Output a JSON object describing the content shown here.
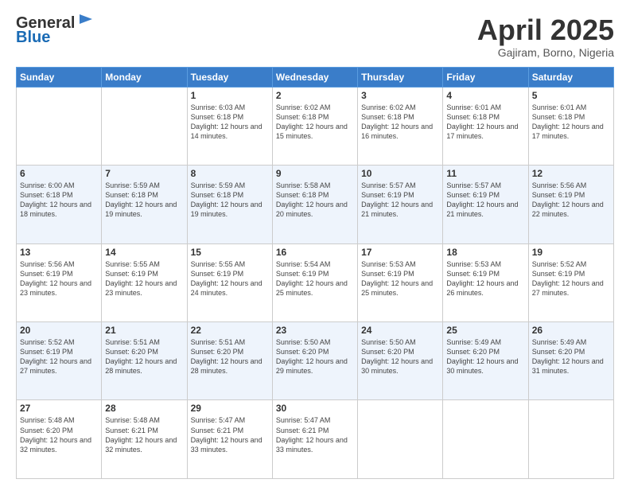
{
  "header": {
    "logo_general": "General",
    "logo_blue": "Blue",
    "month_title": "April 2025",
    "location": "Gajiram, Borno, Nigeria"
  },
  "weekdays": [
    "Sunday",
    "Monday",
    "Tuesday",
    "Wednesday",
    "Thursday",
    "Friday",
    "Saturday"
  ],
  "weeks": [
    [
      {
        "day": "",
        "sunrise": "",
        "sunset": "",
        "daylight": ""
      },
      {
        "day": "",
        "sunrise": "",
        "sunset": "",
        "daylight": ""
      },
      {
        "day": "1",
        "sunrise": "Sunrise: 6:03 AM",
        "sunset": "Sunset: 6:18 PM",
        "daylight": "Daylight: 12 hours and 14 minutes."
      },
      {
        "day": "2",
        "sunrise": "Sunrise: 6:02 AM",
        "sunset": "Sunset: 6:18 PM",
        "daylight": "Daylight: 12 hours and 15 minutes."
      },
      {
        "day": "3",
        "sunrise": "Sunrise: 6:02 AM",
        "sunset": "Sunset: 6:18 PM",
        "daylight": "Daylight: 12 hours and 16 minutes."
      },
      {
        "day": "4",
        "sunrise": "Sunrise: 6:01 AM",
        "sunset": "Sunset: 6:18 PM",
        "daylight": "Daylight: 12 hours and 17 minutes."
      },
      {
        "day": "5",
        "sunrise": "Sunrise: 6:01 AM",
        "sunset": "Sunset: 6:18 PM",
        "daylight": "Daylight: 12 hours and 17 minutes."
      }
    ],
    [
      {
        "day": "6",
        "sunrise": "Sunrise: 6:00 AM",
        "sunset": "Sunset: 6:18 PM",
        "daylight": "Daylight: 12 hours and 18 minutes."
      },
      {
        "day": "7",
        "sunrise": "Sunrise: 5:59 AM",
        "sunset": "Sunset: 6:18 PM",
        "daylight": "Daylight: 12 hours and 19 minutes."
      },
      {
        "day": "8",
        "sunrise": "Sunrise: 5:59 AM",
        "sunset": "Sunset: 6:18 PM",
        "daylight": "Daylight: 12 hours and 19 minutes."
      },
      {
        "day": "9",
        "sunrise": "Sunrise: 5:58 AM",
        "sunset": "Sunset: 6:18 PM",
        "daylight": "Daylight: 12 hours and 20 minutes."
      },
      {
        "day": "10",
        "sunrise": "Sunrise: 5:57 AM",
        "sunset": "Sunset: 6:19 PM",
        "daylight": "Daylight: 12 hours and 21 minutes."
      },
      {
        "day": "11",
        "sunrise": "Sunrise: 5:57 AM",
        "sunset": "Sunset: 6:19 PM",
        "daylight": "Daylight: 12 hours and 21 minutes."
      },
      {
        "day": "12",
        "sunrise": "Sunrise: 5:56 AM",
        "sunset": "Sunset: 6:19 PM",
        "daylight": "Daylight: 12 hours and 22 minutes."
      }
    ],
    [
      {
        "day": "13",
        "sunrise": "Sunrise: 5:56 AM",
        "sunset": "Sunset: 6:19 PM",
        "daylight": "Daylight: 12 hours and 23 minutes."
      },
      {
        "day": "14",
        "sunrise": "Sunrise: 5:55 AM",
        "sunset": "Sunset: 6:19 PM",
        "daylight": "Daylight: 12 hours and 23 minutes."
      },
      {
        "day": "15",
        "sunrise": "Sunrise: 5:55 AM",
        "sunset": "Sunset: 6:19 PM",
        "daylight": "Daylight: 12 hours and 24 minutes."
      },
      {
        "day": "16",
        "sunrise": "Sunrise: 5:54 AM",
        "sunset": "Sunset: 6:19 PM",
        "daylight": "Daylight: 12 hours and 25 minutes."
      },
      {
        "day": "17",
        "sunrise": "Sunrise: 5:53 AM",
        "sunset": "Sunset: 6:19 PM",
        "daylight": "Daylight: 12 hours and 25 minutes."
      },
      {
        "day": "18",
        "sunrise": "Sunrise: 5:53 AM",
        "sunset": "Sunset: 6:19 PM",
        "daylight": "Daylight: 12 hours and 26 minutes."
      },
      {
        "day": "19",
        "sunrise": "Sunrise: 5:52 AM",
        "sunset": "Sunset: 6:19 PM",
        "daylight": "Daylight: 12 hours and 27 minutes."
      }
    ],
    [
      {
        "day": "20",
        "sunrise": "Sunrise: 5:52 AM",
        "sunset": "Sunset: 6:19 PM",
        "daylight": "Daylight: 12 hours and 27 minutes."
      },
      {
        "day": "21",
        "sunrise": "Sunrise: 5:51 AM",
        "sunset": "Sunset: 6:20 PM",
        "daylight": "Daylight: 12 hours and 28 minutes."
      },
      {
        "day": "22",
        "sunrise": "Sunrise: 5:51 AM",
        "sunset": "Sunset: 6:20 PM",
        "daylight": "Daylight: 12 hours and 28 minutes."
      },
      {
        "day": "23",
        "sunrise": "Sunrise: 5:50 AM",
        "sunset": "Sunset: 6:20 PM",
        "daylight": "Daylight: 12 hours and 29 minutes."
      },
      {
        "day": "24",
        "sunrise": "Sunrise: 5:50 AM",
        "sunset": "Sunset: 6:20 PM",
        "daylight": "Daylight: 12 hours and 30 minutes."
      },
      {
        "day": "25",
        "sunrise": "Sunrise: 5:49 AM",
        "sunset": "Sunset: 6:20 PM",
        "daylight": "Daylight: 12 hours and 30 minutes."
      },
      {
        "day": "26",
        "sunrise": "Sunrise: 5:49 AM",
        "sunset": "Sunset: 6:20 PM",
        "daylight": "Daylight: 12 hours and 31 minutes."
      }
    ],
    [
      {
        "day": "27",
        "sunrise": "Sunrise: 5:48 AM",
        "sunset": "Sunset: 6:20 PM",
        "daylight": "Daylight: 12 hours and 32 minutes."
      },
      {
        "day": "28",
        "sunrise": "Sunrise: 5:48 AM",
        "sunset": "Sunset: 6:21 PM",
        "daylight": "Daylight: 12 hours and 32 minutes."
      },
      {
        "day": "29",
        "sunrise": "Sunrise: 5:47 AM",
        "sunset": "Sunset: 6:21 PM",
        "daylight": "Daylight: 12 hours and 33 minutes."
      },
      {
        "day": "30",
        "sunrise": "Sunrise: 5:47 AM",
        "sunset": "Sunset: 6:21 PM",
        "daylight": "Daylight: 12 hours and 33 minutes."
      },
      {
        "day": "",
        "sunrise": "",
        "sunset": "",
        "daylight": ""
      },
      {
        "day": "",
        "sunrise": "",
        "sunset": "",
        "daylight": ""
      },
      {
        "day": "",
        "sunrise": "",
        "sunset": "",
        "daylight": ""
      }
    ]
  ]
}
